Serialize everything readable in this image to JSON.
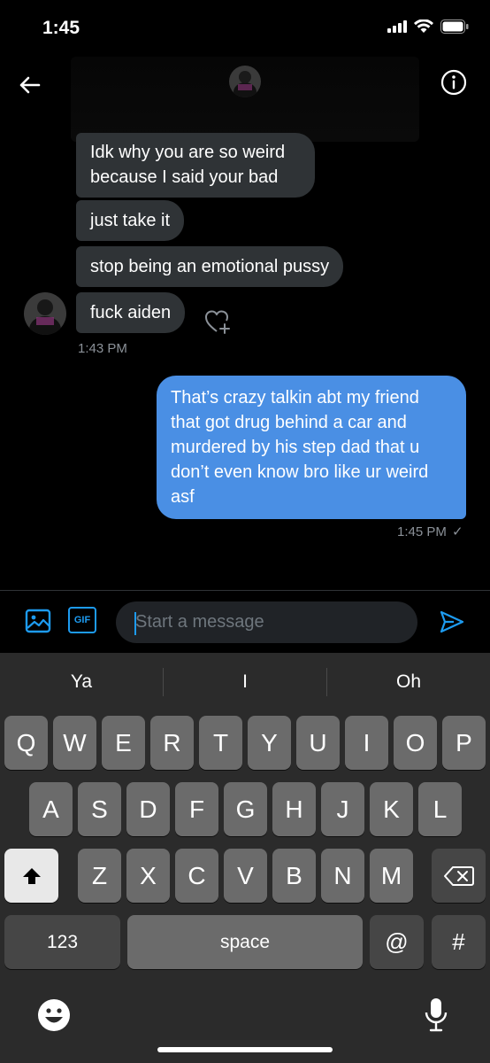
{
  "status_bar": {
    "time": "1:45"
  },
  "header": {
    "back_icon": "back-arrow-icon",
    "info_icon": "info-icon"
  },
  "messages": {
    "incoming": [
      "Idk why you are so weird because I said your bad",
      "just take it",
      "stop being an emotional pussy",
      "fuck aiden"
    ],
    "incoming_time": "1:43 PM",
    "outgoing": "That’s crazy talkin abt my friend that got drug behind a car and murdered by his step dad that u don’t even know bro like ur weird asf",
    "outgoing_time": "1:45 PM",
    "outgoing_check": "✓"
  },
  "composer": {
    "placeholder": "Start a message",
    "gif_label": "GIF"
  },
  "keyboard": {
    "suggestions": [
      "Ya",
      "I",
      "Oh"
    ],
    "row1": [
      "Q",
      "W",
      "E",
      "R",
      "T",
      "Y",
      "U",
      "I",
      "O",
      "P"
    ],
    "row2": [
      "A",
      "S",
      "D",
      "F",
      "G",
      "H",
      "J",
      "K",
      "L"
    ],
    "row3": [
      "Z",
      "X",
      "C",
      "V",
      "B",
      "N",
      "M"
    ],
    "numbers_label": "123",
    "space_label": "space",
    "at_label": "@",
    "hash_label": "#"
  },
  "colors": {
    "accent": "#1d9bf0",
    "outgoing_bubble": "#4a8fe4",
    "incoming_bubble": "#2f3336"
  }
}
